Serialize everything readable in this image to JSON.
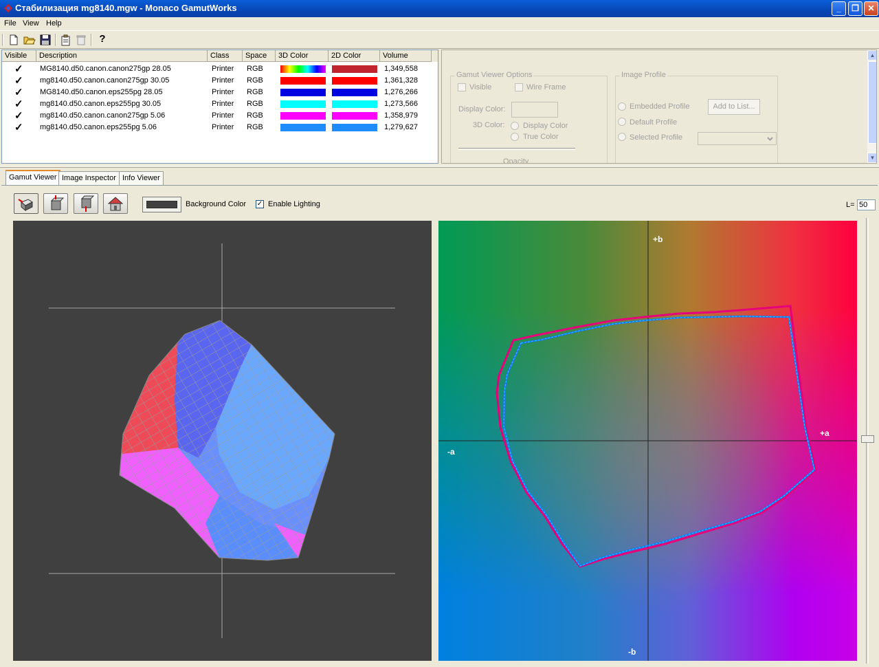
{
  "window": {
    "title": "Стабилизация mg8140.mgw - Monaco GamutWorks",
    "minimize": "_",
    "maximize": "❐",
    "close": "✕"
  },
  "menu": [
    "File",
    "View",
    "Help"
  ],
  "toolbar": {
    "icons": [
      "new-icon",
      "open-icon",
      "save-icon",
      "properties-icon",
      "delete-icon",
      "help-icon"
    ],
    "help_glyph": "?"
  },
  "list": {
    "headers": [
      "Visible",
      "Description",
      "Class",
      "Space",
      "3D Color",
      "2D Color",
      "Volume"
    ],
    "check_glyph": "✓",
    "rows": [
      {
        "description": "MG8140.d50.canon.canon275gp 28.05",
        "class": "Printer",
        "space": "RGB",
        "color3d": "spectrum",
        "color2d": "#c0242e",
        "volume": "1,349,558"
      },
      {
        "description": "mg8140.d50.canon.canon275gp 30.05",
        "class": "Printer",
        "space": "RGB",
        "color3d": "#ff0000",
        "color2d": "#ff0000",
        "volume": "1,361,328"
      },
      {
        "description": "MG8140.d50.canon.eps255pg 28.05",
        "class": "Printer",
        "space": "RGB",
        "color3d": "#0000e0",
        "color2d": "#0000e0",
        "volume": "1,276,266"
      },
      {
        "description": "mg8140.d50.canon.eps255pg 30.05",
        "class": "Printer",
        "space": "RGB",
        "color3d": "#00ffff",
        "color2d": "#00ffff",
        "volume": "1,273,566"
      },
      {
        "description": "mg8140.d50.canon.canon275gp 5.06",
        "class": "Printer",
        "space": "RGB",
        "color3d": "#ff00ff",
        "color2d": "#ff00ff",
        "volume": "1,358,979"
      },
      {
        "description": "mg8140.d50.canon.eps255pg 5.06",
        "class": "Printer",
        "space": "RGB",
        "color3d": "#1e8cff",
        "color2d": "#1e8cff",
        "volume": "1,279,627"
      }
    ]
  },
  "options": {
    "gamut_group": "Gamut Viewer Options",
    "visible": "Visible",
    "wire_frame": "Wire Frame",
    "display_color_label": "Display Color:",
    "color_3d_label": "3D Color:",
    "display_color_radio": "Display Color",
    "true_color_radio": "True Color",
    "opacity_label": "Opacity",
    "image_group": "Image Profile",
    "embedded": "Embedded Profile",
    "default": "Default Profile",
    "selected": "Selected Profile",
    "add_to_list": "Add to List..."
  },
  "tabs": [
    "Gamut Viewer",
    "Image Inspector",
    "Info Viewer"
  ],
  "viewer": {
    "view_buttons": [
      "view-iso-icon",
      "view-top-icon",
      "view-bottom-icon",
      "view-home-icon"
    ],
    "background_color_label": "Background Color",
    "background_color": "#404040",
    "enable_lighting": "Enable Lighting",
    "lighting_checked": "✓",
    "l_label": "L=",
    "l_value": "50"
  },
  "plot2d": {
    "label_pos_b": "+b",
    "label_neg_b": "-b",
    "label_pos_a": "+a",
    "label_neg_a": "-a"
  },
  "colors": {
    "accent": "#0a5fd8",
    "series_magenta": "#ff1493",
    "series_cyan": "#00e5ff",
    "series_blue": "#1e6cff"
  }
}
